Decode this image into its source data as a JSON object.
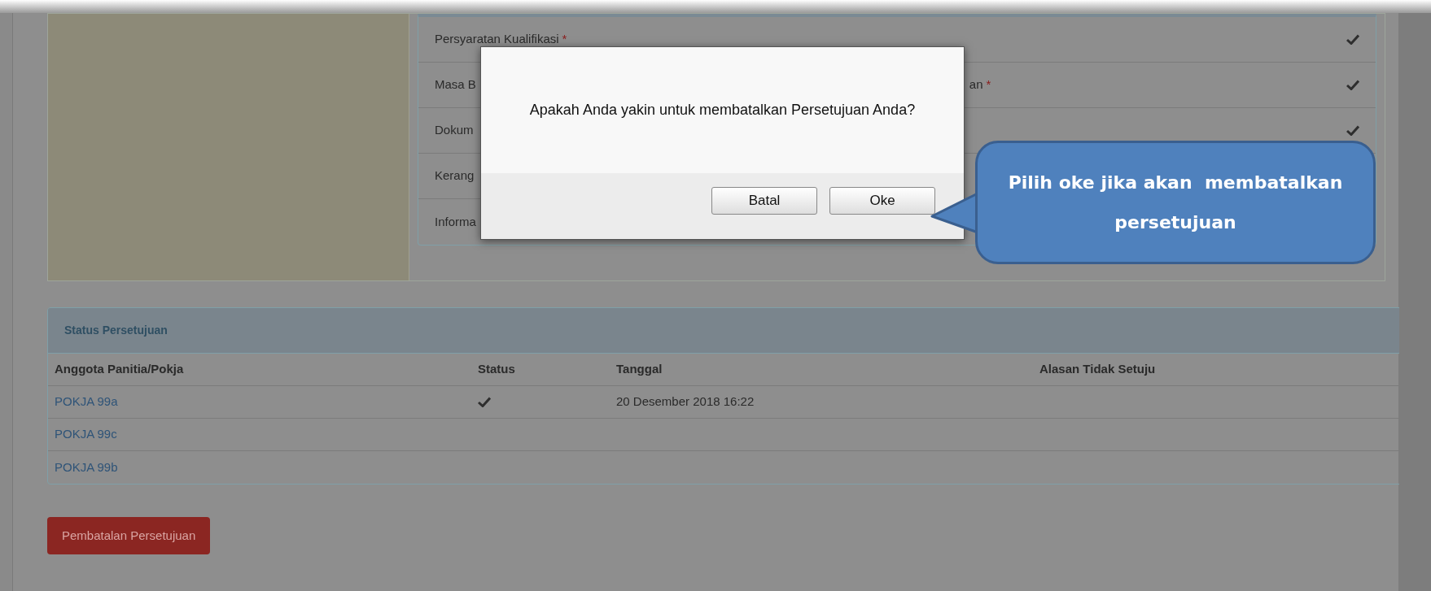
{
  "requirements": [
    {
      "label": "Persyaratan Kualifikasi",
      "required_mark": "*",
      "checked": true
    },
    {
      "label": "Masa B",
      "tail": "an",
      "required_mark": "*",
      "checked": true
    },
    {
      "label": "Dokum",
      "checked": true
    },
    {
      "label": "Kerang"
    },
    {
      "label": "Informa"
    }
  ],
  "status_panel": {
    "title": "Status Persetujuan",
    "columns": [
      "Anggota Panitia/Pokja",
      "Status",
      "Tanggal",
      "Alasan Tidak Setuju"
    ],
    "rows": [
      {
        "member": "POKJA 99a",
        "approved": true,
        "date": "20 Desember 2018 16:22"
      },
      {
        "member": "POKJA 99c"
      },
      {
        "member": "POKJA 99b"
      }
    ]
  },
  "cancel_button": "Pembatalan Persetujuan",
  "dialog": {
    "message": "Apakah Anda yakin untuk membatalkan Persetujuan Anda?",
    "buttons": [
      "Batal",
      "Oke"
    ]
  },
  "callout": {
    "lines": [
      "Pilih oke jika akan  membatalkan",
      "persetujuan"
    ]
  }
}
